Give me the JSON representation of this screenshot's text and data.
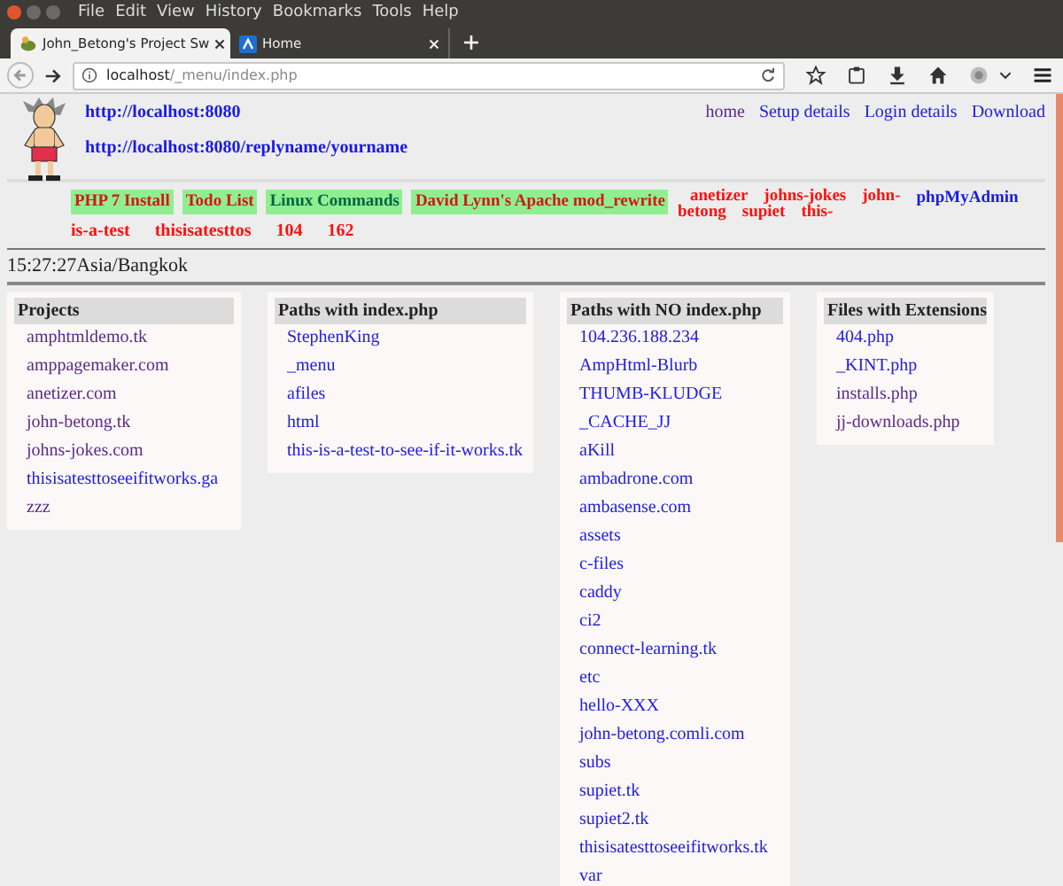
{
  "menu_bar": [
    "File",
    "Edit",
    "View",
    "History",
    "Bookmarks",
    "Tools",
    "Help"
  ],
  "tabs": [
    {
      "title": "John_Betong's Project Sw",
      "selected": true
    },
    {
      "title": "Home",
      "selected": false
    }
  ],
  "address": {
    "host": "localhost",
    "path": "/_menu/index.php"
  },
  "header": {
    "links": [
      "http://localhost:8080",
      "http://localhost:8080/replyname/yourname"
    ],
    "nav": [
      {
        "label": "home",
        "visited": true
      },
      {
        "label": "Setup details",
        "visited": false
      },
      {
        "label": "Login details",
        "visited": false
      },
      {
        "label": "Download",
        "visited": false
      }
    ],
    "green_buttons": [
      "PHP 7 Install",
      "Todo List",
      "Linux Commands",
      "David Lynn's Apache mod_rewrite"
    ],
    "red_links": [
      [
        "anetizer",
        "johns-jokes",
        "john-"
      ],
      [
        "betong",
        "supiet",
        "this-"
      ]
    ],
    "admin_link": "phpMyAdmin",
    "overflow_links": [
      "is-a-test",
      "thisisatesttos",
      "104",
      "162"
    ]
  },
  "clock": "15:27:27Asia/Bangkok",
  "panels": [
    {
      "title": "Projects",
      "items": [
        {
          "label": "amphtmldemo.tk",
          "visited": true
        },
        {
          "label": "amppagemaker.com",
          "visited": true
        },
        {
          "label": "anetizer.com",
          "visited": true
        },
        {
          "label": "john-betong.tk",
          "visited": true
        },
        {
          "label": "johns-jokes.com",
          "visited": true
        },
        {
          "label": "thisisatesttoseeifitworks.ga",
          "visited": false
        },
        {
          "label": "zzz",
          "visited": true
        }
      ]
    },
    {
      "title": "Paths with index.php",
      "items": [
        {
          "label": "StephenKing",
          "visited": false
        },
        {
          "label": "_menu",
          "visited": false
        },
        {
          "label": "afiles",
          "visited": false
        },
        {
          "label": "html",
          "visited": false
        },
        {
          "label": "this-is-a-test-to-see-if-it-works.tk",
          "visited": false
        }
      ]
    },
    {
      "title": "Paths with NO index.php",
      "items": [
        {
          "label": "104.236.188.234",
          "visited": false
        },
        {
          "label": "AmpHtml-Blurb",
          "visited": false
        },
        {
          "label": "THUMB-KLUDGE",
          "visited": false
        },
        {
          "label": "_CACHE_JJ",
          "visited": false
        },
        {
          "label": "aKill",
          "visited": false
        },
        {
          "label": "ambadrone.com",
          "visited": false
        },
        {
          "label": "ambasense.com",
          "visited": false
        },
        {
          "label": "assets",
          "visited": false
        },
        {
          "label": "c-files",
          "visited": false
        },
        {
          "label": "caddy",
          "visited": false
        },
        {
          "label": "ci2",
          "visited": false
        },
        {
          "label": "connect-learning.tk",
          "visited": false
        },
        {
          "label": "etc",
          "visited": false
        },
        {
          "label": "hello-XXX",
          "visited": false
        },
        {
          "label": "john-betong.comli.com",
          "visited": false
        },
        {
          "label": "subs",
          "visited": false
        },
        {
          "label": "supiet.tk",
          "visited": false
        },
        {
          "label": "supiet2.tk",
          "visited": false
        },
        {
          "label": "thisisatesttoseeifitworks.tk",
          "visited": false
        },
        {
          "label": "var",
          "visited": false
        }
      ]
    },
    {
      "title": "Files with Extensions",
      "items": [
        {
          "label": "404.php",
          "visited": false
        },
        {
          "label": "_KINT.php",
          "visited": false
        },
        {
          "label": "installs.php",
          "visited": true
        },
        {
          "label": "jj-downloads.php",
          "visited": true
        }
      ]
    }
  ]
}
